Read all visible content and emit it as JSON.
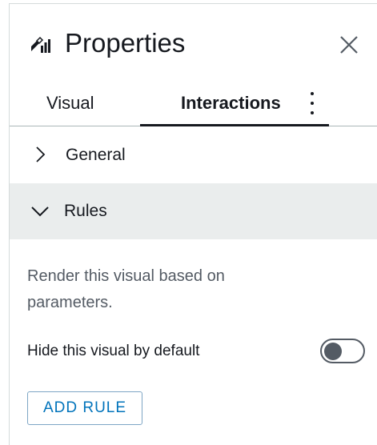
{
  "header": {
    "title": "Properties",
    "icon": "chart-settings-icon",
    "close_icon": "close-icon"
  },
  "tabs": [
    {
      "label": "Visual",
      "active": false
    },
    {
      "label": "Interactions",
      "active": true
    }
  ],
  "more_icon": "more-vertical-icon",
  "sections": {
    "general": {
      "label": "General",
      "expanded": false
    },
    "rules": {
      "label": "Rules",
      "expanded": true
    }
  },
  "rules": {
    "description": "Render this visual based on parameters.",
    "hide_label": "Hide this visual by default",
    "hide_toggle_on": false,
    "add_rule_label": "ADD RULE"
  },
  "colors": {
    "text": "#16191f",
    "muted_text": "#545b64",
    "section_bg": "#eaeded",
    "button_text": "#0073bb",
    "button_border": "#7ea6c5"
  }
}
